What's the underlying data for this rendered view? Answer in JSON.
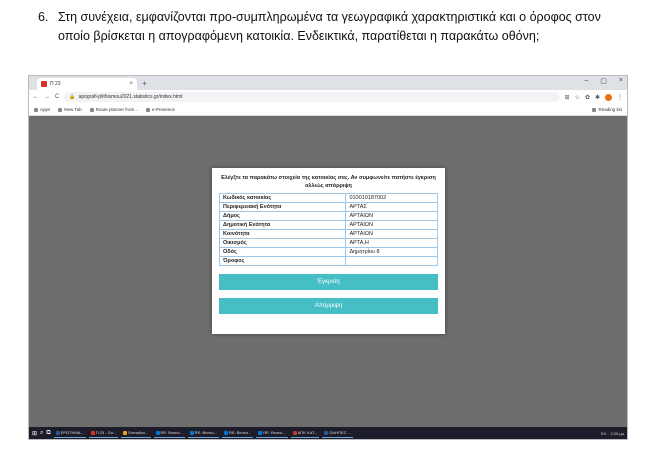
{
  "instruction": {
    "number": "6.",
    "text": "Στη συνέχεια, εμφανίζονται προ-συμπληρωμένα τα γεωγραφικά χαρακτηριστικά και ο όροφος στον οποίο βρίσκεται η απογραφόμενη κατοικία. Ενδεικτικά, παρατίθεται η παρακάτω οθόνη;"
  },
  "browser": {
    "tab_title": "Π 23",
    "tab_close": "×",
    "new_tab": "+",
    "window_controls": [
      "–",
      "▢",
      "×"
    ],
    "nav": [
      "←",
      "→",
      "C"
    ],
    "url": "apografi-plithismou2021.statistics.gr/index.html",
    "bookmarks": [
      "Apps",
      "New Tab",
      "Route planner from...",
      "e-Presence"
    ],
    "reading_list": "Reading list"
  },
  "dialog": {
    "header": "Ελέγξτε τα παρακάτω στοιχεία της κατοικίας σας. Αν συμφωνείτε πατήστε έγκριση αλλιώς απόρριψη",
    "rows": [
      {
        "label": "Κωδικός κατοικίας",
        "value": "010010187002"
      },
      {
        "label": "Περιφερειακή Ενότητα",
        "value": "ΑΡΤΑΣ"
      },
      {
        "label": "Δήμος",
        "value": "ΑΡΤΑΙΩΝ"
      },
      {
        "label": "Δημοτική Ενότητα",
        "value": "ΑΡΤΑΙΩΝ"
      },
      {
        "label": "Κοινότητα",
        "value": "ΑΡΤΑΙΩΝ"
      },
      {
        "label": "Οικισμός",
        "value": "ΑΡΤΑ,Η"
      },
      {
        "label": "Οδός",
        "value": "Δημητρίου 8"
      },
      {
        "label": "Όροφος",
        "value": ""
      }
    ],
    "approve_label": "Έγκριση",
    "reject_label": "Απόρριψη",
    "button_color": "#45bec4"
  },
  "taskbar": {
    "items": [
      {
        "label": "ΕΡΩΤΗΜΑ...",
        "color": "#2b579a"
      },
      {
        "label": "Π 23 - Go...",
        "color": "#d93025"
      },
      {
        "label": "Εκπαιδευ...",
        "color": "#e8a317"
      },
      {
        "label": "RE: Βιντεο...",
        "color": "#0078d4"
      },
      {
        "label": "RE: Βιντεο...",
        "color": "#0078d4"
      },
      {
        "label": "RE: Βιντεο...",
        "color": "#0078d4"
      },
      {
        "label": "RE: Βιντεο...",
        "color": "#0078d4"
      },
      {
        "label": "ΑΠΚ ΚΑΤ...",
        "color": "#c0392b"
      },
      {
        "label": "ΟΔΗΓΙΕΣ ...",
        "color": "#2b579a"
      }
    ],
    "lang": "ΕΛ",
    "time": "2:20 μμ"
  }
}
